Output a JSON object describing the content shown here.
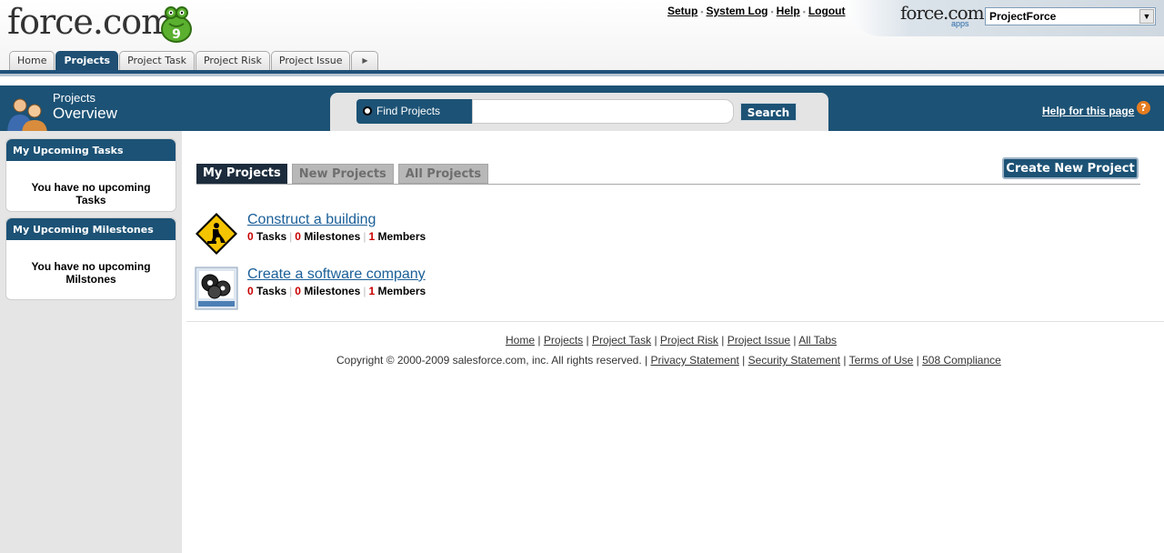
{
  "header": {
    "logo_text": "force.com",
    "links": [
      "Setup",
      "System Log",
      "Help",
      "Logout"
    ],
    "apps_logo": "force.com",
    "apps_sub": "apps",
    "app_selector": "ProjectForce"
  },
  "tabs": [
    {
      "label": "Home",
      "active": false
    },
    {
      "label": "Projects",
      "active": true
    },
    {
      "label": "Project Task",
      "active": false
    },
    {
      "label": "Project Risk",
      "active": false
    },
    {
      "label": "Project Issue",
      "active": false
    }
  ],
  "page": {
    "title_line1": "Projects",
    "title_line2": "Overview",
    "find_label": "Find Projects",
    "search_value": "",
    "search_button": "Search",
    "help_link": "Help for this page",
    "help_icon": "?"
  },
  "sidebar": {
    "tasks_title": "My Upcoming Tasks",
    "tasks_text": "You have no upcoming Tasks",
    "milestones_title": "My Upcoming Milestones",
    "milestones_text": "You have no upcoming Milstones"
  },
  "main": {
    "tabs": [
      {
        "label": "My Projects",
        "active": true
      },
      {
        "label": "New Projects",
        "active": false
      },
      {
        "label": "All Projects",
        "active": false
      }
    ],
    "create_button": "Create New Project",
    "projects": [
      {
        "name": "Construct a building",
        "tasks": "0",
        "milestones": "0",
        "members": "1",
        "icon": "construction-sign-icon"
      },
      {
        "name": "Create a software company",
        "tasks": "0",
        "milestones": "0",
        "members": "1",
        "icon": "gears-icon"
      }
    ],
    "labels": {
      "tasks": "Tasks",
      "milestones": "Milestones",
      "members": "Members"
    }
  },
  "footer": {
    "links": [
      "Home",
      "Projects",
      "Project Task",
      "Project Risk",
      "Project Issue",
      "All Tabs"
    ],
    "copyright": "Copyright © 2000-2009 salesforce.com, inc. All rights reserved.",
    "legal_links": [
      "Privacy Statement",
      "Security Statement",
      "Terms of Use",
      "508 Compliance"
    ]
  },
  "colors": {
    "brand": "#1c5275",
    "link": "#1a5f98",
    "count": "#c80000",
    "help": "#e57c20"
  }
}
